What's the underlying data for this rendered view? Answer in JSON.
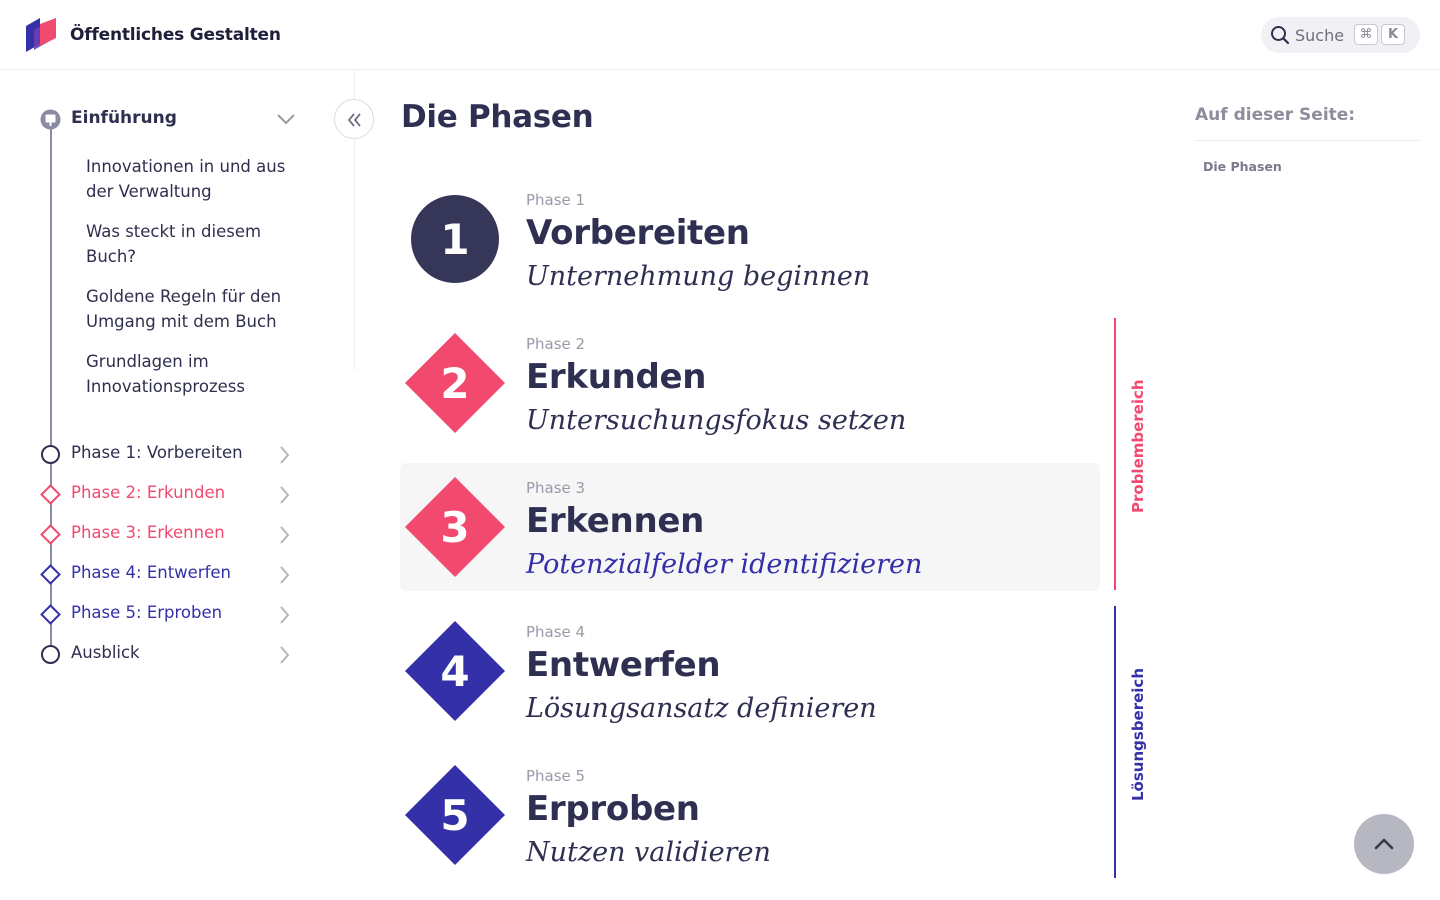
{
  "header": {
    "brand": "Öffentliches Gestalten",
    "search_label": "Suche",
    "kbd_cmd": "⌘",
    "kbd_k": "K"
  },
  "colors": {
    "navy": "#2f2f52",
    "pink": "#f2496e",
    "indigo": "#3330a8",
    "gray_text": "#9a9aaa"
  },
  "sidebar": {
    "intro": {
      "label": "Einführung",
      "icon": "intro-book-icon",
      "subitems": [
        "Innovationen in und aus der Verwaltung",
        "Was steckt in diesem Buch?",
        "Goldene Regeln für den Umgang mit dem Buch",
        "Grundlagen im Innovationsprozess"
      ]
    },
    "items": [
      {
        "label": "Phase 1: Vorbereiten",
        "icon": "circle-icon",
        "color": "#2f2f52"
      },
      {
        "label": "Phase 2: Erkunden",
        "icon": "diamond-icon",
        "color": "#f2496e"
      },
      {
        "label": "Phase 3: Erkennen",
        "icon": "diamond-icon",
        "color": "#f2496e"
      },
      {
        "label": "Phase 4: Entwerfen",
        "icon": "diamond-icon",
        "color": "#3330a8"
      },
      {
        "label": "Phase 5: Erproben",
        "icon": "diamond-icon",
        "color": "#3330a8"
      },
      {
        "label": "Ausblick",
        "icon": "circle-icon",
        "color": "#2f2f52"
      }
    ]
  },
  "main": {
    "title": "Die Phasen",
    "phases": [
      {
        "number": "1",
        "small": "Phase 1",
        "name": "Vorbereiten",
        "desc": "Unternehmung beginnen",
        "shape": "circle",
        "color": "#363658"
      },
      {
        "number": "2",
        "small": "Phase 2",
        "name": "Erkunden",
        "desc": "Untersuchungsfokus setzen",
        "shape": "diamond",
        "color": "#f2496e"
      },
      {
        "number": "3",
        "small": "Phase 3",
        "name": "Erkennen",
        "desc": "Potenzialfelder identifizieren",
        "shape": "diamond",
        "color": "#f2496e"
      },
      {
        "number": "4",
        "small": "Phase 4",
        "name": "Entwerfen",
        "desc": "Lösungsansatz definieren",
        "shape": "diamond",
        "color": "#3330a8"
      },
      {
        "number": "5",
        "small": "Phase 5",
        "name": "Erproben",
        "desc": "Nutzen validieren",
        "shape": "diamond",
        "color": "#3330a8"
      }
    ],
    "ranges": [
      {
        "label": "Problembereich",
        "color": "#f2496e"
      },
      {
        "label": "Lösungsbereich",
        "color": "#3330a8"
      }
    ]
  },
  "toc": {
    "title": "Auf dieser Seite:",
    "links": [
      "Die Phasen"
    ]
  }
}
